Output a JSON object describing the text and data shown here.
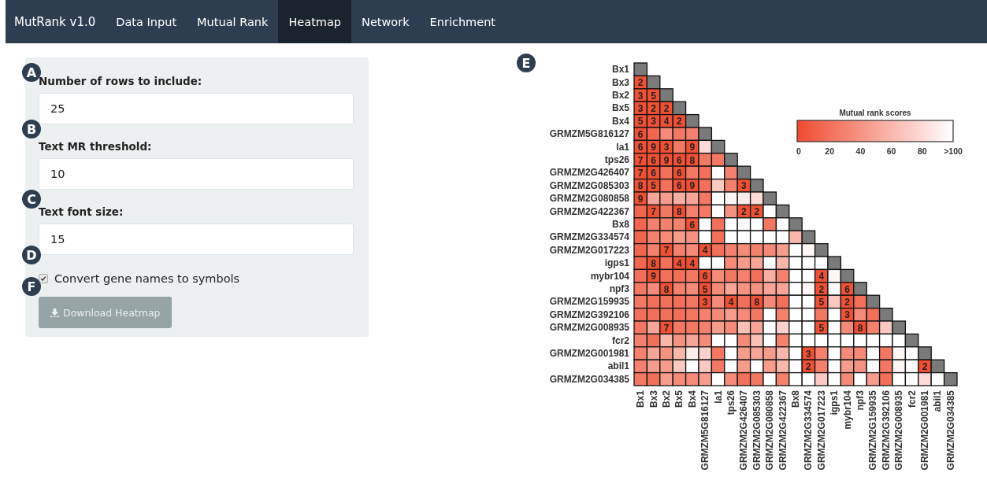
{
  "navbar": {
    "brand": "MutRank v1.0",
    "tabs": [
      {
        "label": "Data Input",
        "selected": false
      },
      {
        "label": "Mutual Rank",
        "selected": false
      },
      {
        "label": "Heatmap",
        "selected": true
      },
      {
        "label": "Network",
        "selected": false
      },
      {
        "label": "Enrichment",
        "selected": false
      }
    ]
  },
  "panel": {
    "fields": [
      {
        "badge": "A",
        "label": "Number of rows to include:",
        "value": "25"
      },
      {
        "badge": "B",
        "label": "Text MR threshold:",
        "value": "10"
      },
      {
        "badge": "C",
        "label": "Text font size:",
        "value": "15"
      }
    ],
    "checkbox": {
      "badge": "D",
      "label": "Convert gene names to symbols",
      "checked": true
    },
    "button": {
      "badge": "F",
      "label": "Download Heatmap",
      "disabled": true
    }
  },
  "heatmap": {
    "badge": "E",
    "rows": [
      {
        "gene": "Bx1"
      },
      {
        "gene": "Bx3",
        "cells": [
          {
            "label": "2",
            "color": "#f05034"
          }
        ]
      },
      {
        "gene": "Bx2",
        "cells": [
          {
            "label": "3",
            "color": "#f05034"
          },
          {
            "label": "5",
            "color": "#f05034"
          }
        ]
      },
      {
        "gene": "Bx5",
        "cells": [
          {
            "label": "3",
            "color": "#f05034"
          },
          {
            "label": "2",
            "color": "#f05034"
          },
          {
            "label": "2",
            "color": "#f05034"
          }
        ]
      },
      {
        "gene": "Bx4",
        "cells": [
          {
            "label": "5",
            "color": "#f05034"
          },
          {
            "label": "3",
            "color": "#f05034"
          },
          {
            "label": "4",
            "color": "#f05034"
          },
          {
            "label": "2",
            "color": "#f05034"
          }
        ]
      },
      {
        "gene": "GRMZM5G816127",
        "cells": [
          {
            "label": "6",
            "color": "#f05034"
          },
          {
            "color": "#f1664f"
          },
          {
            "color": "#f58a78"
          },
          {
            "color": "#f37864"
          },
          {
            "color": "#f4816e"
          }
        ]
      },
      {
        "gene": "la1",
        "cells": [
          {
            "label": "6",
            "color": "#f05034"
          },
          {
            "label": "9",
            "color": "#f05034"
          },
          {
            "label": "3",
            "color": "#f05034"
          },
          {
            "color": "#f37864"
          },
          {
            "label": "9",
            "color": "#f05034"
          },
          {
            "color": "#fcdbd6"
          }
        ]
      },
      {
        "gene": "tps26",
        "cells": [
          {
            "label": "7",
            "color": "#f05034"
          },
          {
            "label": "6",
            "color": "#f05034"
          },
          {
            "label": "9",
            "color": "#f05034"
          },
          {
            "label": "6",
            "color": "#f05034"
          },
          {
            "label": "8",
            "color": "#f05034"
          },
          {
            "color": "#f37864"
          },
          {
            "color": "#f37864"
          }
        ]
      },
      {
        "gene": "GRMZM2G426407",
        "cells": [
          {
            "label": "7",
            "color": "#f05034"
          },
          {
            "label": "6",
            "color": "#f05034"
          },
          {
            "color": "#f26f59"
          },
          {
            "label": "6",
            "color": "#f05034"
          },
          {
            "color": "#f37864"
          },
          {
            "color": "#f26f59"
          },
          {
            "color": "#ffffff"
          },
          {
            "color": "#f4816e"
          }
        ]
      },
      {
        "gene": "GRMZM2G085303",
        "cells": [
          {
            "label": "8",
            "color": "#f05034"
          },
          {
            "label": "5",
            "color": "#f05034"
          },
          {
            "color": "#f26f59"
          },
          {
            "label": "6",
            "color": "#f05034"
          },
          {
            "label": "9",
            "color": "#f05034"
          },
          {
            "color": "#f26f59"
          },
          {
            "color": "#fac9c1"
          },
          {
            "color": "#f4816e"
          },
          {
            "label": "3",
            "color": "#f05034"
          }
        ]
      },
      {
        "gene": "GRMZM2G080858",
        "cells": [
          {
            "label": "9",
            "color": "#f05034"
          },
          {
            "color": "#f7a598"
          },
          {
            "color": "#f69c8d"
          },
          {
            "color": "#f8aea2"
          },
          {
            "color": "#f7a598"
          },
          {
            "color": "#f37864"
          },
          {
            "color": "#ffffff"
          },
          {
            "color": "#fef6f5"
          },
          {
            "color": "#fdedea"
          },
          {
            "color": "#fcdbd6"
          }
        ]
      },
      {
        "gene": "GRMZM2G422367",
        "cells": [
          {
            "color": "#f1664f"
          },
          {
            "label": "7",
            "color": "#f05034"
          },
          {
            "color": "#f37864"
          },
          {
            "label": "8",
            "color": "#f05034"
          },
          {
            "color": "#f4816e"
          },
          {
            "color": "#f37864"
          },
          {
            "color": "#ffffff"
          },
          {
            "color": "#f59383"
          },
          {
            "label": "2",
            "color": "#f05034"
          },
          {
            "label": "2",
            "color": "#f05034"
          },
          {
            "color": "#ffffff"
          }
        ]
      },
      {
        "gene": "Bx8",
        "cells": [
          {
            "color": "#f1664f"
          },
          {
            "color": "#f4816e"
          },
          {
            "color": "#f4816e"
          },
          {
            "color": "#f4816e"
          },
          {
            "label": "6",
            "color": "#f05034"
          },
          {
            "color": "#ffffff"
          },
          {
            "color": "#f26f59"
          },
          {
            "color": "#ffffff"
          },
          {
            "color": "#ffffff"
          },
          {
            "color": "#ffffff"
          },
          {
            "color": "#f37864"
          },
          {
            "color": "#ffffff"
          }
        ]
      },
      {
        "gene": "GRMZM2G334574",
        "cells": [
          {
            "color": "#f1664f"
          },
          {
            "color": "#f4816e"
          },
          {
            "color": "#f58a78"
          },
          {
            "color": "#f69c8d"
          },
          {
            "color": "#f59383"
          },
          {
            "color": "#ffffff"
          },
          {
            "color": "#f26f59"
          },
          {
            "color": "#ffffff"
          },
          {
            "color": "#ffffff"
          },
          {
            "color": "#ffffff"
          },
          {
            "color": "#ffffff"
          },
          {
            "color": "#ffffff"
          },
          {
            "color": "#f9b7ac"
          }
        ]
      },
      {
        "gene": "GRMZM2G017223",
        "cells": [
          {
            "color": "#f1664f"
          },
          {
            "color": "#f4816e"
          },
          {
            "label": "7",
            "color": "#f05034"
          },
          {
            "color": "#f4816e"
          },
          {
            "color": "#f58a78"
          },
          {
            "label": "4",
            "color": "#f05034"
          },
          {
            "color": "#f26f59"
          },
          {
            "color": "#f4816e"
          },
          {
            "color": "#f58a78"
          },
          {
            "color": "#f4816e"
          },
          {
            "color": "#f58a78"
          },
          {
            "color": "#f69c8d"
          },
          {
            "color": "#ffffff"
          },
          {
            "color": "#fef6f5"
          }
        ]
      },
      {
        "gene": "igps1",
        "cells": [
          {
            "color": "#f1664f"
          },
          {
            "label": "8",
            "color": "#f05034"
          },
          {
            "color": "#f26f59"
          },
          {
            "label": "4",
            "color": "#f05034"
          },
          {
            "label": "4",
            "color": "#f05034"
          },
          {
            "color": "#ffffff"
          },
          {
            "color": "#ffffff"
          },
          {
            "color": "#f58a78"
          },
          {
            "color": "#f69c8d"
          },
          {
            "color": "#f7a598"
          },
          {
            "color": "#ffffff"
          },
          {
            "color": "#f9b7ac"
          },
          {
            "color": "#ffffff"
          },
          {
            "color": "#ffffff"
          },
          {
            "color": "#ffffff"
          }
        ]
      },
      {
        "gene": "mybr104",
        "cells": [
          {
            "color": "#f26f59"
          },
          {
            "label": "9",
            "color": "#f05034"
          },
          {
            "color": "#f26f59"
          },
          {
            "color": "#f26f59"
          },
          {
            "color": "#f37864"
          },
          {
            "label": "6",
            "color": "#f05034"
          },
          {
            "color": "#f58a78"
          },
          {
            "color": "#f37864"
          },
          {
            "color": "#f4816e"
          },
          {
            "color": "#f26f59"
          },
          {
            "color": "#f8aea2"
          },
          {
            "color": "#f4816e"
          },
          {
            "color": "#ffffff"
          },
          {
            "color": "#ffffff"
          },
          {
            "label": "4",
            "color": "#f05034"
          },
          {
            "color": "#fef6f5"
          }
        ]
      },
      {
        "gene": "npf3",
        "cells": [
          {
            "color": "#f37864"
          },
          {
            "color": "#f58a78"
          },
          {
            "label": "8",
            "color": "#f05034"
          },
          {
            "color": "#f4816e"
          },
          {
            "color": "#f58a78"
          },
          {
            "label": "5",
            "color": "#f05034"
          },
          {
            "color": "#f58a78"
          },
          {
            "color": "#f7a598"
          },
          {
            "color": "#f59383"
          },
          {
            "color": "#f59383"
          },
          {
            "color": "#f7a598"
          },
          {
            "color": "#f7a598"
          },
          {
            "color": "#ffffff"
          },
          {
            "color": "#fef6f5"
          },
          {
            "label": "2",
            "color": "#f05034"
          },
          {
            "color": "#ffffff"
          },
          {
            "label": "6",
            "color": "#f05034"
          }
        ]
      },
      {
        "gene": "GRMZM2G159935",
        "cells": [
          {
            "color": "#f37864"
          },
          {
            "color": "#f26f59"
          },
          {
            "color": "#f26f59"
          },
          {
            "color": "#f26f59"
          },
          {
            "color": "#f37864"
          },
          {
            "label": "3",
            "color": "#f05034"
          },
          {
            "color": "#f58a78"
          },
          {
            "label": "4",
            "color": "#f05034"
          },
          {
            "color": "#f26f59"
          },
          {
            "label": "8",
            "color": "#f05034"
          },
          {
            "color": "#f58a78"
          },
          {
            "color": "#f26f59"
          },
          {
            "color": "#ffffff"
          },
          {
            "color": "#ffffff"
          },
          {
            "label": "5",
            "color": "#f05034"
          },
          {
            "color": "#fac9c1"
          },
          {
            "label": "2",
            "color": "#f05034"
          },
          {
            "color": "#f26f59"
          }
        ]
      },
      {
        "gene": "GRMZM2G392106",
        "cells": [
          {
            "color": "#f26f59"
          },
          {
            "color": "#f26f59"
          },
          {
            "color": "#f26f59"
          },
          {
            "color": "#f26f59"
          },
          {
            "color": "#f37864"
          },
          {
            "color": "#f4816e"
          },
          {
            "color": "#f58a78"
          },
          {
            "color": "#f69c8d"
          },
          {
            "color": "#f58a78"
          },
          {
            "color": "#f37864"
          },
          {
            "color": "#ffffff"
          },
          {
            "color": "#f4816e"
          },
          {
            "color": "#ffffff"
          },
          {
            "color": "#ffffff"
          },
          {
            "color": "#f37864"
          },
          {
            "color": "#ffffff"
          },
          {
            "label": "3",
            "color": "#f05034"
          },
          {
            "color": "#f58a78"
          },
          {
            "color": "#f26f59"
          }
        ]
      },
      {
        "gene": "GRMZM2G008935",
        "cells": [
          {
            "color": "#f37864"
          },
          {
            "color": "#f7a598"
          },
          {
            "label": "7",
            "color": "#f05034"
          },
          {
            "color": "#f37864"
          },
          {
            "color": "#f37864"
          },
          {
            "color": "#f4816e"
          },
          {
            "color": "#f69c8d"
          },
          {
            "color": "#f58a78"
          },
          {
            "color": "#f9c0b7"
          },
          {
            "color": "#f7a598"
          },
          {
            "color": "#ffffff"
          },
          {
            "color": "#fbd2cb"
          },
          {
            "color": "#ffffff"
          },
          {
            "color": "#ffffff"
          },
          {
            "label": "5",
            "color": "#f05034"
          },
          {
            "color": "#ffffff"
          },
          {
            "color": "#f58a78"
          },
          {
            "label": "8",
            "color": "#f05034"
          },
          {
            "color": "#f4816e"
          },
          {
            "color": "#fac9c1"
          }
        ]
      },
      {
        "gene": "fcr2",
        "cells": [
          {
            "color": "#f4816e"
          },
          {
            "color": "#f26f59"
          },
          {
            "color": "#f9b7ac"
          },
          {
            "color": "#f59383"
          },
          {
            "color": "#f7a598"
          },
          {
            "color": "#f58a78"
          },
          {
            "color": "#ffffff"
          },
          {
            "color": "#ffffff"
          },
          {
            "color": "#f58a78"
          },
          {
            "color": "#f9c0b7"
          },
          {
            "color": "#ffffff"
          },
          {
            "color": "#f4816e"
          },
          {
            "color": "#ffffff"
          },
          {
            "color": "#ffffff"
          },
          {
            "color": "#ffffff"
          },
          {
            "color": "#ffffff"
          },
          {
            "color": "#ffffff"
          },
          {
            "color": "#ffffff"
          },
          {
            "color": "#ffffff"
          },
          {
            "color": "#ffffff"
          },
          {
            "color": "#ffffff"
          }
        ]
      },
      {
        "gene": "GRMZM2G001981",
        "cells": [
          {
            "color": "#f4816e"
          },
          {
            "color": "#f7a598"
          },
          {
            "color": "#f59383"
          },
          {
            "color": "#f9b7ac"
          },
          {
            "color": "#fdedea"
          },
          {
            "color": "#fbd2cb"
          },
          {
            "color": "#f37864"
          },
          {
            "color": "#ffffff"
          },
          {
            "color": "#f69c8d"
          },
          {
            "color": "#f7a598"
          },
          {
            "color": "#f69c8d"
          },
          {
            "color": "#f9b7ac"
          },
          {
            "color": "#ffffff"
          },
          {
            "label": "3",
            "color": "#f05034"
          },
          {
            "color": "#f4816e"
          },
          {
            "color": "#ffffff"
          },
          {
            "color": "#f58a78"
          },
          {
            "color": "#f58a78"
          },
          {
            "color": "#ffffff"
          },
          {
            "color": "#f37864"
          },
          {
            "color": "#fef6f5"
          },
          {
            "color": "#ffffff"
          }
        ]
      },
      {
        "gene": "abil1",
        "cells": [
          {
            "color": "#f4816e"
          },
          {
            "color": "#f69c8d"
          },
          {
            "color": "#f69c8d"
          },
          {
            "color": "#fac9c1"
          },
          {
            "color": "#ffffff"
          },
          {
            "color": "#fac9c1"
          },
          {
            "color": "#f37864"
          },
          {
            "color": "#ffffff"
          },
          {
            "color": "#f69c8d"
          },
          {
            "color": "#ffffff"
          },
          {
            "color": "#f69c8d"
          },
          {
            "color": "#f9b7ac"
          },
          {
            "color": "#ffffff"
          },
          {
            "label": "2",
            "color": "#f05034"
          },
          {
            "color": "#f4816e"
          },
          {
            "color": "#ffffff"
          },
          {
            "color": "#f69c8d"
          },
          {
            "color": "#f59383"
          },
          {
            "color": "#ffffff"
          },
          {
            "color": "#f37864"
          },
          {
            "color": "#fef6f5"
          },
          {
            "color": "#ffffff"
          },
          {
            "label": "2",
            "color": "#f05034"
          }
        ]
      },
      {
        "gene": "GRMZM2G034385",
        "cells": [
          {
            "color": "#f37864"
          },
          {
            "color": "#f26f59"
          },
          {
            "color": "#f69c8d"
          },
          {
            "color": "#f58a78"
          },
          {
            "color": "#f58a78"
          },
          {
            "color": "#f69c8d"
          },
          {
            "color": "#ffffff"
          },
          {
            "color": "#f58a78"
          },
          {
            "color": "#f26f59"
          },
          {
            "color": "#f37864"
          },
          {
            "color": "#ffffff"
          },
          {
            "color": "#f4816e"
          },
          {
            "color": "#ffffff"
          },
          {
            "color": "#ffffff"
          },
          {
            "color": "#fac9c1"
          },
          {
            "color": "#ffffff"
          },
          {
            "color": "#f58a78"
          },
          {
            "color": "#ffffff"
          },
          {
            "color": "#f69c8d"
          },
          {
            "color": "#f26f59"
          },
          {
            "color": "#ffffff"
          },
          {
            "color": "#ffffff"
          },
          {
            "color": "#fcdbd6"
          },
          {
            "color": "#ffffff"
          }
        ]
      }
    ],
    "column_labels": [
      "Bx1",
      "Bx3",
      "Bx2",
      "Bx5",
      "Bx4",
      "GRMZM5G816127",
      "la1",
      "tps26",
      "GRMZM2G426407",
      "GRMZM2G085303",
      "GRMZM2G080858",
      "GRMZM2G422367",
      "Bx8",
      "GRMZM2G334574",
      "GRMZM2G017223",
      "igps1",
      "mybr104",
      "npf3",
      "GRMZM2G159935",
      "GRMZM2G392106",
      "GRMZM2G008935",
      "fcr2",
      "GRMZM2G001981",
      "abil1",
      "GRMZM2G034385"
    ],
    "legend": {
      "title": "Mutual rank scores",
      "ticks": [
        "0",
        "20",
        "40",
        "60",
        "80",
        ">100"
      ]
    }
  }
}
